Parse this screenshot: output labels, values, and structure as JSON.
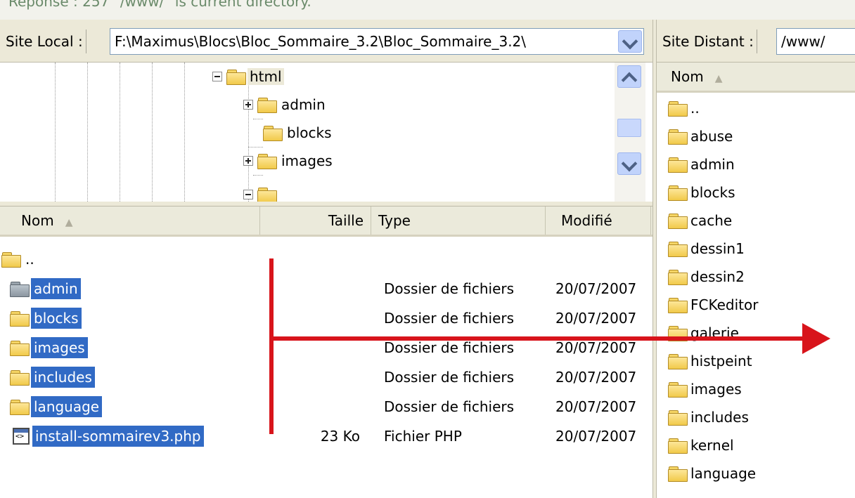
{
  "top_strip_text": "Réponse :      257 \"/www/\" is current directory.",
  "local": {
    "label": "Site Local :",
    "path": "F:\\Maximus\\Blocs\\Bloc_Sommaire_3.2\\Bloc_Sommaire_3.2\\",
    "tree": [
      {
        "label": "html",
        "expander": "minus"
      },
      {
        "label": "admin",
        "expander": "plus"
      },
      {
        "label": "blocks",
        "expander": "none"
      },
      {
        "label": "images",
        "expander": "plus"
      }
    ],
    "columns": {
      "name": "Nom",
      "size": "Taille",
      "type": "Type",
      "modified": "Modifié"
    },
    "files": [
      {
        "name": "..",
        "size": "",
        "type": "",
        "modified": "",
        "selected": false,
        "icon": "folder-icon"
      },
      {
        "name": "admin",
        "size": "",
        "type": "Dossier de fichiers",
        "modified": "20/07/2007",
        "selected": true,
        "icon": "folder-icon"
      },
      {
        "name": "blocks",
        "size": "",
        "type": "Dossier de fichiers",
        "modified": "20/07/2007",
        "selected": true,
        "icon": "folder-icon"
      },
      {
        "name": "images",
        "size": "",
        "type": "Dossier de fichiers",
        "modified": "20/07/2007",
        "selected": true,
        "icon": "folder-icon"
      },
      {
        "name": "includes",
        "size": "",
        "type": "Dossier de fichiers",
        "modified": "20/07/2007",
        "selected": true,
        "icon": "folder-icon"
      },
      {
        "name": "language",
        "size": "",
        "type": "Dossier de fichiers",
        "modified": "20/07/2007",
        "selected": true,
        "icon": "folder-icon"
      },
      {
        "name": "install-sommairev3.php",
        "size": "23 Ko",
        "type": "Fichier PHP",
        "modified": "20/07/2007",
        "selected": true,
        "icon": "php-file-icon"
      }
    ]
  },
  "remote": {
    "label": "Site Distant :",
    "path": "/www/",
    "column_name": "Nom",
    "files": [
      "..",
      "abuse",
      "admin",
      "blocks",
      "cache",
      "dessin1",
      "dessin2",
      "FCKeditor",
      "galerie",
      "histpeint",
      "images",
      "includes",
      "kernel",
      "language"
    ]
  },
  "colors": {
    "selection": "#316ac5",
    "annotation_arrow": "#d8141b"
  }
}
